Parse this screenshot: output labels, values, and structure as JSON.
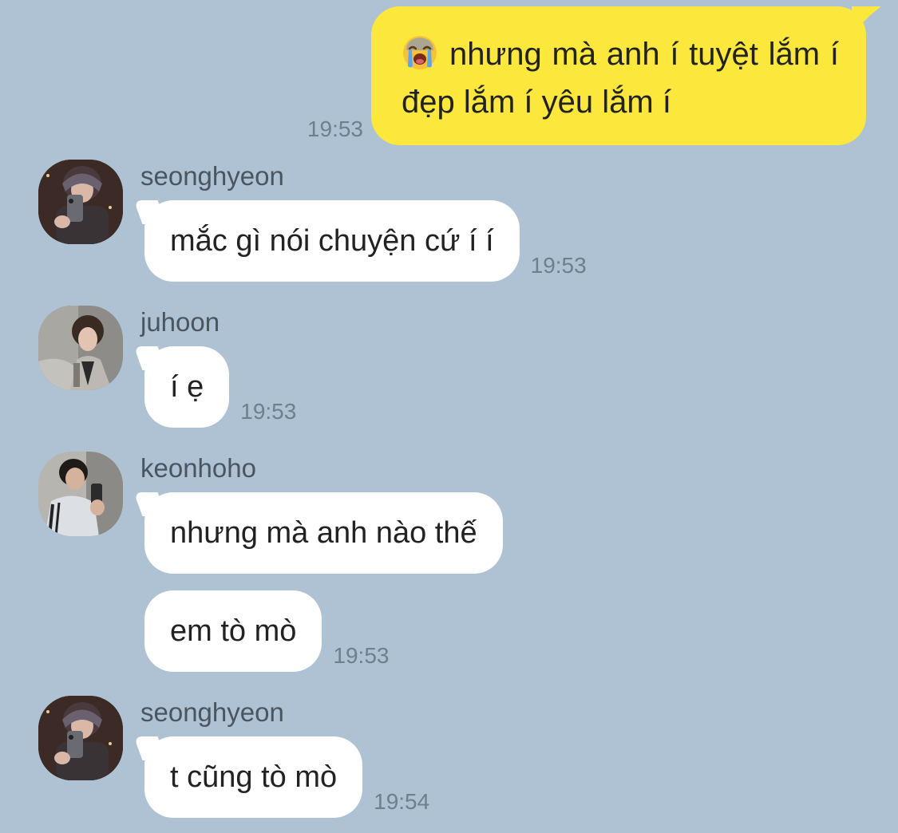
{
  "colors": {
    "background": "#aec2d4",
    "sent_bubble": "#fce83d",
    "received_bubble": "#ffffff",
    "timestamp": "#6e7f8e",
    "sender_name": "#4a5560"
  },
  "sent_message": {
    "emoji": "loudly-crying-face",
    "text": "nhưng mà anh í tuyệt lắm í đẹp lắm í yêu lắm í",
    "time": "19:53"
  },
  "groups": [
    {
      "sender": "seonghyeon",
      "avatar": "avatar-seonghyeon",
      "messages": [
        {
          "text": "mắc gì nói chuyện cứ í í",
          "time": "19:53"
        }
      ]
    },
    {
      "sender": "juhoon",
      "avatar": "avatar-juhoon",
      "messages": [
        {
          "text": "í ẹ",
          "time": "19:53"
        }
      ]
    },
    {
      "sender": "keonhoho",
      "avatar": "avatar-keonhoho",
      "messages": [
        {
          "text": "nhưng mà anh nào thế",
          "time": ""
        },
        {
          "text": "em tò mò",
          "time": "19:53"
        }
      ]
    },
    {
      "sender": "seonghyeon",
      "avatar": "avatar-seonghyeon",
      "messages": [
        {
          "text": "t cũng tò mò",
          "time": "19:54"
        }
      ]
    }
  ]
}
